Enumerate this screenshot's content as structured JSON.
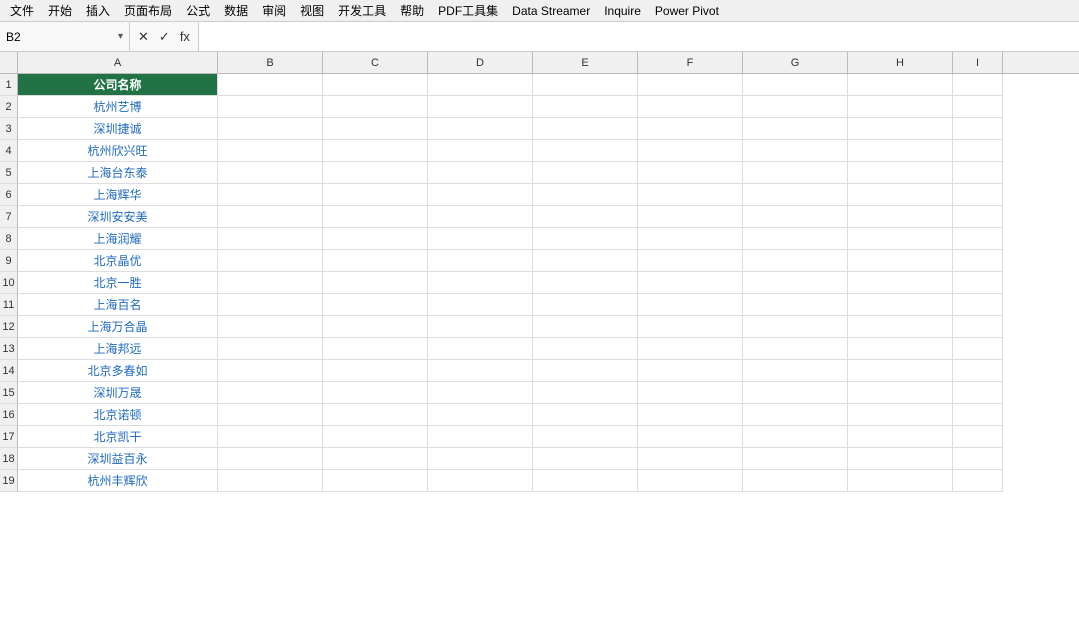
{
  "menu": {
    "items": [
      "文件",
      "开始",
      "插入",
      "页面布局",
      "公式",
      "数据",
      "审阅",
      "视图",
      "开发工具",
      "帮助",
      "PDF工具集",
      "Data Streamer",
      "Inquire",
      "Power Pivot"
    ]
  },
  "formula_bar": {
    "cell_ref": "B2",
    "cancel_label": "✕",
    "confirm_label": "✓",
    "fx_label": "fx",
    "formula_value": ""
  },
  "columns": {
    "headers": [
      "A",
      "B",
      "C",
      "D",
      "E",
      "F",
      "G",
      "H",
      "I"
    ]
  },
  "rows": [
    {
      "row_num": "1",
      "a": "公司名称",
      "is_header": true
    },
    {
      "row_num": "2",
      "a": "杭州艺博",
      "is_header": false
    },
    {
      "row_num": "3",
      "a": "深圳捷诚",
      "is_header": false
    },
    {
      "row_num": "4",
      "a": "杭州欣兴旺",
      "is_header": false
    },
    {
      "row_num": "5",
      "a": "上海台东泰",
      "is_header": false
    },
    {
      "row_num": "6",
      "a": "上海辉华",
      "is_header": false
    },
    {
      "row_num": "7",
      "a": "深圳安安美",
      "is_header": false
    },
    {
      "row_num": "8",
      "a": "上海润耀",
      "is_header": false
    },
    {
      "row_num": "9",
      "a": "北京晶优",
      "is_header": false
    },
    {
      "row_num": "10",
      "a": "北京一胜",
      "is_header": false
    },
    {
      "row_num": "11",
      "a": "上海百名",
      "is_header": false
    },
    {
      "row_num": "12",
      "a": "上海万合晶",
      "is_header": false
    },
    {
      "row_num": "13",
      "a": "上海邦远",
      "is_header": false
    },
    {
      "row_num": "14",
      "a": "北京多春如",
      "is_header": false
    },
    {
      "row_num": "15",
      "a": "深圳万晟",
      "is_header": false
    },
    {
      "row_num": "16",
      "a": "北京诺顿",
      "is_header": false
    },
    {
      "row_num": "17",
      "a": "北京凯干",
      "is_header": false
    },
    {
      "row_num": "18",
      "a": "深圳益百永",
      "is_header": false
    },
    {
      "row_num": "19",
      "a": "杭州丰辉欣",
      "is_header": false
    }
  ],
  "colors": {
    "header_bg": "#217346",
    "header_text": "#ffffff",
    "data_text": "#1f6bbf",
    "grid_border": "#dddddd",
    "col_header_bg": "#f0f0f0"
  }
}
